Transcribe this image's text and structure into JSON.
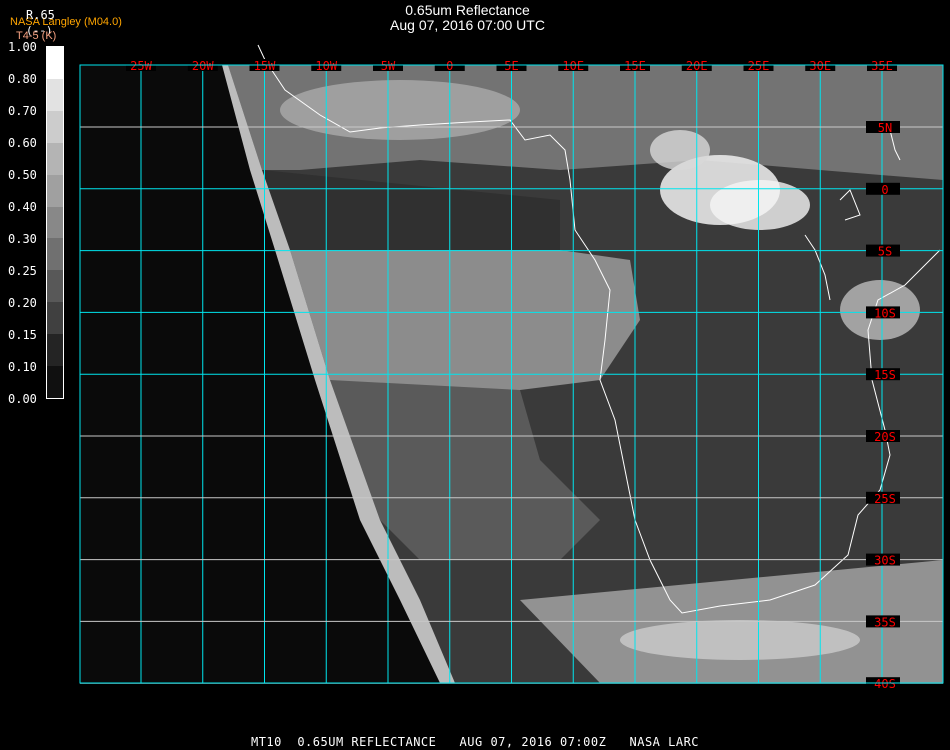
{
  "header": {
    "title": "0.65um Reflectance",
    "datetime": "Aug 07, 2016 07:00 UTC",
    "product": "R.65",
    "product_unit": "(--)",
    "organization": "NASA Langley (M04.0)",
    "channel_label": "T4-5 (K)"
  },
  "colorbar": {
    "labels": [
      "1.00",
      "0.80",
      "0.70",
      "0.60",
      "0.50",
      "0.40",
      "0.30",
      "0.25",
      "0.20",
      "0.15",
      "0.10",
      "0.00"
    ],
    "colors": [
      "#ffffff",
      "#e2e2e2",
      "#cccccc",
      "#b4b4b4",
      "#a0a0a0",
      "#888888",
      "#707070",
      "#585858",
      "#404040",
      "#242424",
      "#101010"
    ]
  },
  "map": {
    "longitude_labels": [
      "25W",
      "20W",
      "15W",
      "10W",
      "5W",
      "0",
      "5E",
      "10E",
      "15E",
      "20E",
      "25E",
      "30E",
      "35E"
    ],
    "latitude_labels": [
      "5N",
      "0",
      "5S",
      "10S",
      "15S",
      "20S",
      "25S",
      "30S",
      "35S",
      "40S"
    ],
    "grid_color": "#00e5ee",
    "label_color": "#ff0000",
    "coastline_color": "#ffffff"
  },
  "footer": {
    "text": "MT10  0.65UM REFLECTANCE   AUG 07, 2016 07:00Z   NASA LARC"
  }
}
